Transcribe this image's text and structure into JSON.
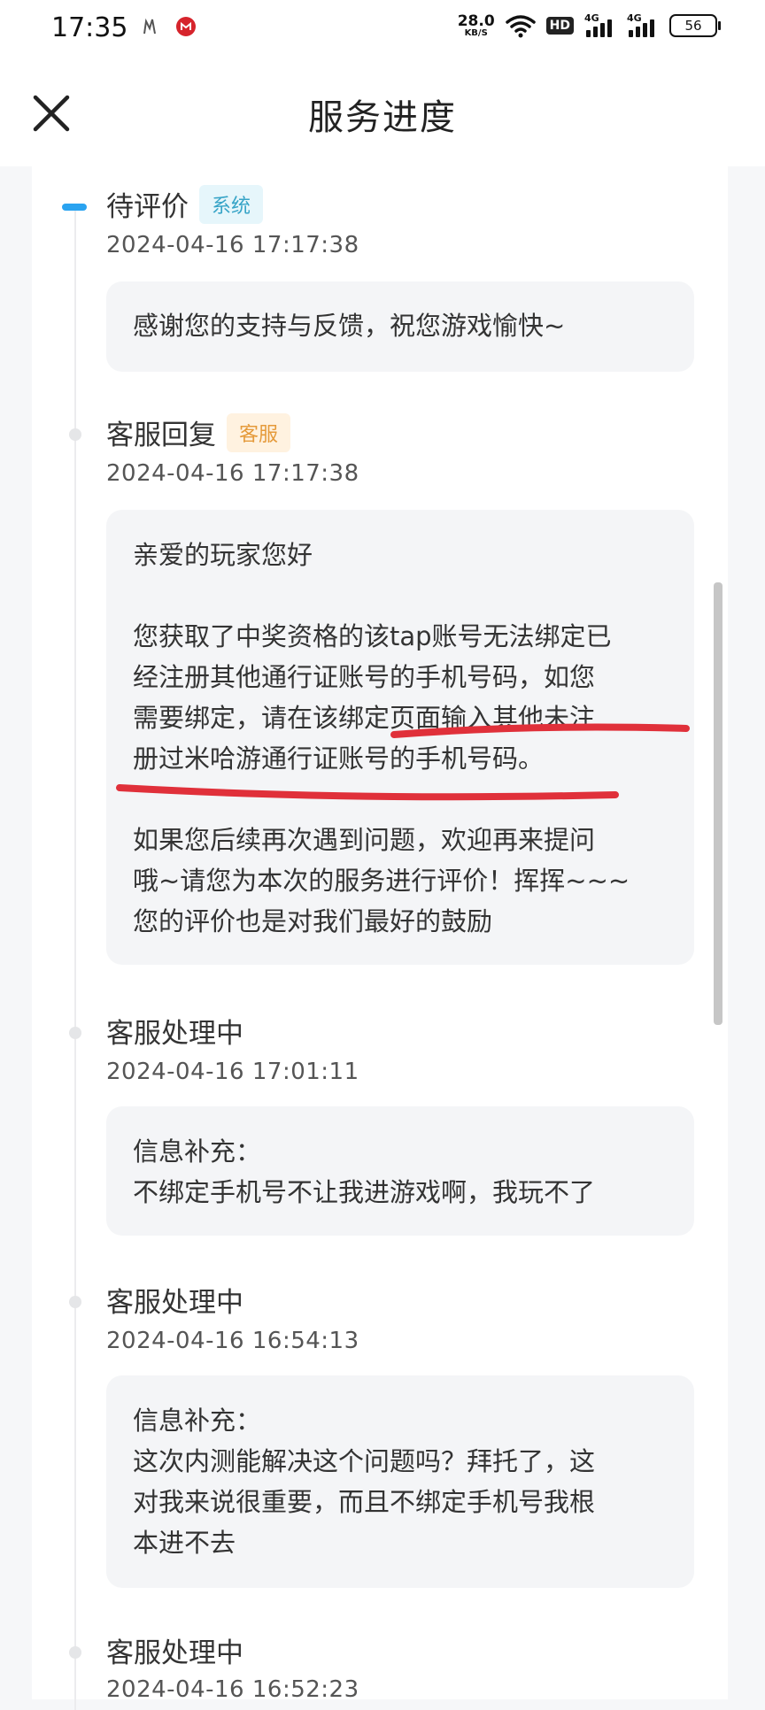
{
  "status_bar": {
    "time": "17:35",
    "net_speed_value": "28.0",
    "net_speed_unit": "KB/S",
    "hd_label": "HD",
    "signal1_label": "4G",
    "signal2_label": "4G",
    "battery": "56"
  },
  "header": {
    "title": "服务进度"
  },
  "timeline": [
    {
      "title": "待评价",
      "tag": "系统",
      "time": "2024-04-16 17:17:38",
      "lines": [
        "感谢您的支持与反馈，祝您游戏愉快~"
      ]
    },
    {
      "title": "客服回复",
      "tag": "客服",
      "time": "2024-04-16 17:17:38",
      "greeting": "亲爱的玩家您好",
      "para1": [
        "您获取了中奖资格的该tap账号无法绑定已",
        "经注册其他通行证账号的手机号码，如您",
        "需要绑定，请在该绑定页面输入其他未注",
        "册过米哈游通行证账号的手机号码。"
      ],
      "para2": [
        "如果您后续再次遇到问题，欢迎再来提问",
        "哦~请您为本次的服务进行评价！挥挥~~~",
        "您的评价也是对我们最好的鼓励"
      ]
    },
    {
      "title": "客服处理中",
      "time": "2024-04-16 17:01:11",
      "lines": [
        "信息补充：",
        "不绑定手机号不让我进游戏啊，我玩不了"
      ]
    },
    {
      "title": "客服处理中",
      "time": "2024-04-16 16:54:13",
      "lines": [
        "信息补充：",
        "这次内测能解决这个问题吗？拜托了，这",
        "对我来说很重要，而且不绑定手机号我根",
        "本进不去"
      ]
    },
    {
      "title": "客服处理中",
      "time": "2024-04-16 16:52:23"
    }
  ],
  "colors": {
    "accent_blue": "#2aa3f0",
    "system_tag": "#37a4c7",
    "cs_tag": "#e59a3a",
    "annotation_red": "#e0303a"
  }
}
